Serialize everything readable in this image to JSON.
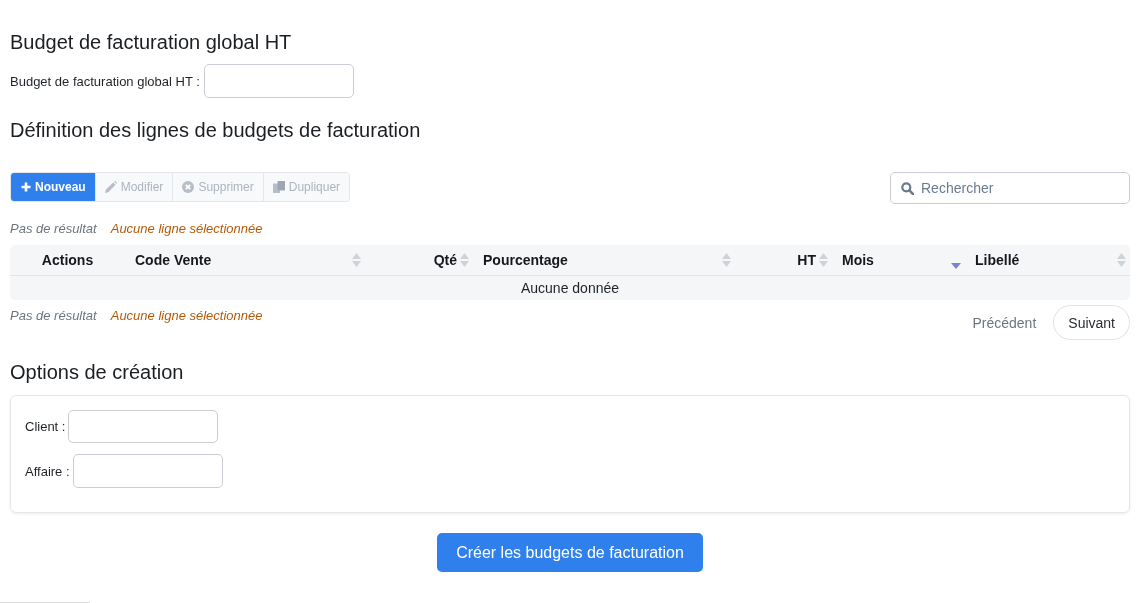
{
  "budget_section": {
    "title": "Budget de facturation global HT",
    "field": {
      "label": "Budget de facturation global HT :"
    }
  },
  "lines_section": {
    "title": "Définition des lignes de budgets de facturation",
    "toolbar": [
      {
        "kind": "new",
        "label": "Nouveau",
        "disabled": false
      },
      {
        "kind": "edit",
        "label": "Modifier",
        "disabled": true
      },
      {
        "kind": "delete",
        "label": "Supprimer",
        "disabled": true
      },
      {
        "kind": "duplicate",
        "label": "Dupliquer",
        "disabled": true
      }
    ],
    "search": {
      "placeholder": "Rechercher"
    },
    "info_top": {
      "result": "Pas de résultat",
      "selection": "Aucune ligne sélectionnée"
    },
    "table": {
      "columns": [
        {
          "label": "Actions",
          "numeric": false,
          "sortable": false,
          "sorted": false
        },
        {
          "label": "Code Vente",
          "numeric": false,
          "sortable": true,
          "sorted": false
        },
        {
          "label": "Qté",
          "numeric": true,
          "sortable": true,
          "sorted": false
        },
        {
          "label": "Pourcentage",
          "numeric": false,
          "sortable": true,
          "sorted": false
        },
        {
          "label": "HT",
          "numeric": true,
          "sortable": true,
          "sorted": false
        },
        {
          "label": "Mois",
          "numeric": false,
          "sortable": true,
          "sorted": true
        },
        {
          "label": "Libellé",
          "numeric": false,
          "sortable": true,
          "sorted": false
        }
      ],
      "empty_message": "Aucune donnée"
    },
    "info_bottom": {
      "result": "Pas de résultat",
      "selection": "Aucune ligne sélectionnée"
    },
    "pagination": [
      {
        "label": "Précédent",
        "disabled": true
      },
      {
        "label": "Suivant",
        "disabled": false
      }
    ]
  },
  "options_section": {
    "title": "Options de création",
    "fields": [
      {
        "label": "Client :"
      },
      {
        "label": "Affaire :"
      }
    ]
  },
  "submit_button": {
    "label": "Créer les budgets de facturation"
  }
}
